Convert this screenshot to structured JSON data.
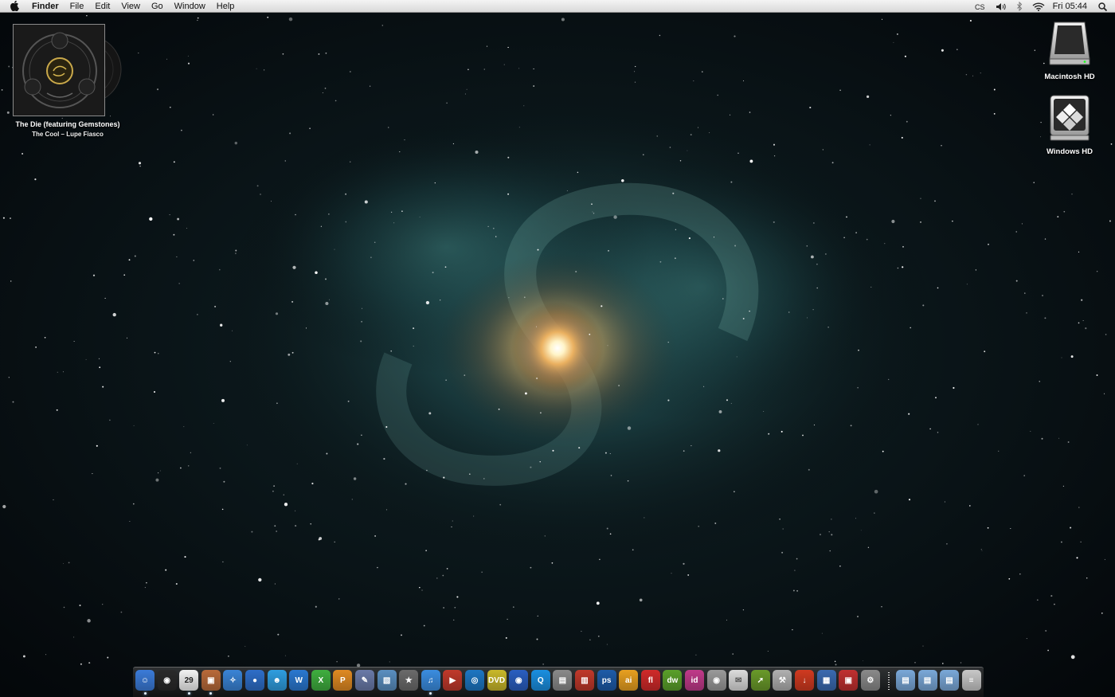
{
  "menubar": {
    "apple_icon": "apple-logo-icon",
    "app_name": "Finder",
    "menus": [
      "File",
      "Edit",
      "View",
      "Go",
      "Window",
      "Help"
    ],
    "status_items": [
      "cs-input-icon",
      "volume-icon",
      "bluetooth-icon",
      "wifi-icon"
    ],
    "status_cs_label": "CS",
    "clock": "Fri 05:44",
    "search_icon": "spotlight-search-icon"
  },
  "now_playing": {
    "track": "The Die (featuring Gemstones)",
    "album_artist": "The Cool – Lupe Fiasco"
  },
  "desktop_icons": [
    {
      "label": "Macintosh HD",
      "icon": "hard-drive-icon"
    },
    {
      "label": "Windows HD",
      "icon": "windows-drive-icon"
    }
  ],
  "dock": {
    "date_badge": "29",
    "apps": [
      {
        "name": "finder",
        "color": "#3b7bd8",
        "glyph": "☺",
        "running": true
      },
      {
        "name": "dashboard",
        "color": "#2a2a2a",
        "glyph": "◉",
        "running": false
      },
      {
        "name": "ical",
        "color": "#f2f2f2",
        "glyph": "29",
        "running": true
      },
      {
        "name": "preview",
        "color": "#b86a3a",
        "glyph": "▣",
        "running": true
      },
      {
        "name": "safari",
        "color": "#3a84d6",
        "glyph": "✧",
        "running": false
      },
      {
        "name": "firefox",
        "color": "#2e6ec8",
        "glyph": "●",
        "running": false
      },
      {
        "name": "messenger",
        "color": "#2f9ee0",
        "glyph": "☻",
        "running": false
      },
      {
        "name": "word",
        "color": "#2a78d0",
        "glyph": "W",
        "running": false
      },
      {
        "name": "excel",
        "color": "#3fae3f",
        "glyph": "X",
        "running": false
      },
      {
        "name": "powerpoint",
        "color": "#e08a22",
        "glyph": "P",
        "running": false
      },
      {
        "name": "script-editor",
        "color": "#6a7aa8",
        "glyph": "✎",
        "running": false
      },
      {
        "name": "iphoto",
        "color": "#5a8fc0",
        "glyph": "▧",
        "running": false
      },
      {
        "name": "imovie",
        "color": "#6b6b6b",
        "glyph": "★",
        "running": false
      },
      {
        "name": "itunes",
        "color": "#3b8de0",
        "glyph": "♫",
        "running": true
      },
      {
        "name": "front-row",
        "color": "#c0392b",
        "glyph": "▶",
        "running": false
      },
      {
        "name": "vlc",
        "color": "#1d76c2",
        "glyph": "◎",
        "running": false
      },
      {
        "name": "dvd-player",
        "color": "#c9b82a",
        "glyph": "DVD",
        "running": false
      },
      {
        "name": "media-player",
        "color": "#2a5ec0",
        "glyph": "◉",
        "running": false
      },
      {
        "name": "quicktime",
        "color": "#1a8fe0",
        "glyph": "Q",
        "running": false
      },
      {
        "name": "image-capture",
        "color": "#8a8a8a",
        "glyph": "▤",
        "running": false
      },
      {
        "name": "photo-booth",
        "color": "#c0392b",
        "glyph": "▥",
        "running": false
      },
      {
        "name": "photoshop",
        "color": "#1d5ba8",
        "glyph": "ps",
        "running": false
      },
      {
        "name": "illustrator",
        "color": "#e8a020",
        "glyph": "ai",
        "running": false
      },
      {
        "name": "flash",
        "color": "#d02a2a",
        "glyph": "fl",
        "running": false
      },
      {
        "name": "dreamweaver",
        "color": "#5aa02a",
        "glyph": "dw",
        "running": false
      },
      {
        "name": "indesign",
        "color": "#c03a8a",
        "glyph": "id",
        "running": false
      },
      {
        "name": "screenshot",
        "color": "#9a9a9a",
        "glyph": "◉",
        "running": false
      },
      {
        "name": "mail",
        "color": "#dcdcdc",
        "glyph": "✉",
        "running": false
      },
      {
        "name": "transmit",
        "color": "#6a9a2a",
        "glyph": "➚",
        "running": false
      },
      {
        "name": "utility",
        "color": "#b0b0b0",
        "glyph": "⚒",
        "running": false
      },
      {
        "name": "flashget",
        "color": "#d03a20",
        "glyph": "↓",
        "running": false
      },
      {
        "name": "spaces",
        "color": "#3a6ab0",
        "glyph": "▦",
        "running": false
      },
      {
        "name": "parallels",
        "color": "#c03030",
        "glyph": "▣",
        "running": false
      },
      {
        "name": "system-preferences",
        "color": "#8a8a8a",
        "glyph": "⚙",
        "running": false
      }
    ],
    "stacks": [
      {
        "name": "downloads-stack",
        "color": "#7aa8d8"
      },
      {
        "name": "documents-stack",
        "color": "#7aa8d8"
      },
      {
        "name": "applications-stack",
        "color": "#7aa8d8"
      },
      {
        "name": "trash",
        "color": "#c8c8c8"
      }
    ]
  }
}
